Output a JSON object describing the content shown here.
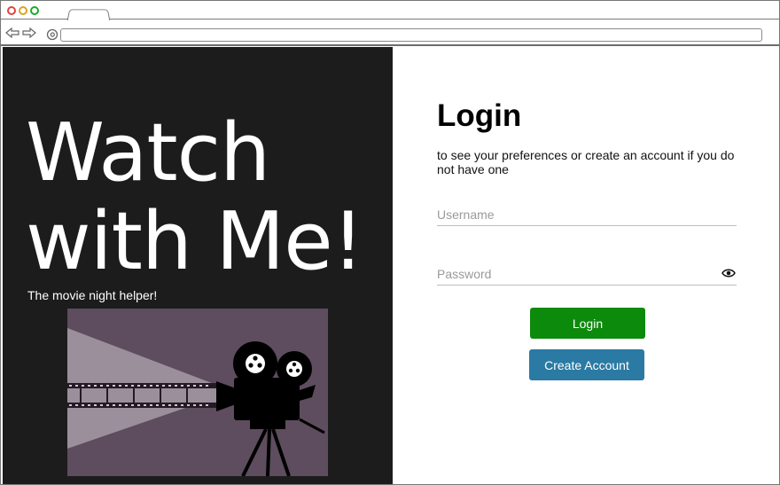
{
  "browser": {
    "icons": [
      "back-arrow-icon",
      "forward-arrow-icon",
      "at-sign-icon"
    ]
  },
  "hero": {
    "line1": "Watch",
    "line2": "with Me!",
    "tagline": "The movie night helper!"
  },
  "login": {
    "title": "Login",
    "subtitle": "to see your preferences or create an account if you do not have one",
    "username_placeholder": "Username",
    "password_placeholder": "Password",
    "login_label": "Login",
    "create_label": "Create Account"
  },
  "colors": {
    "left_panel": "#1c1c1c",
    "illustration_bg": "#5e4d5e",
    "login_button": "#0c8a0c",
    "create_button": "#2a7aa3"
  }
}
